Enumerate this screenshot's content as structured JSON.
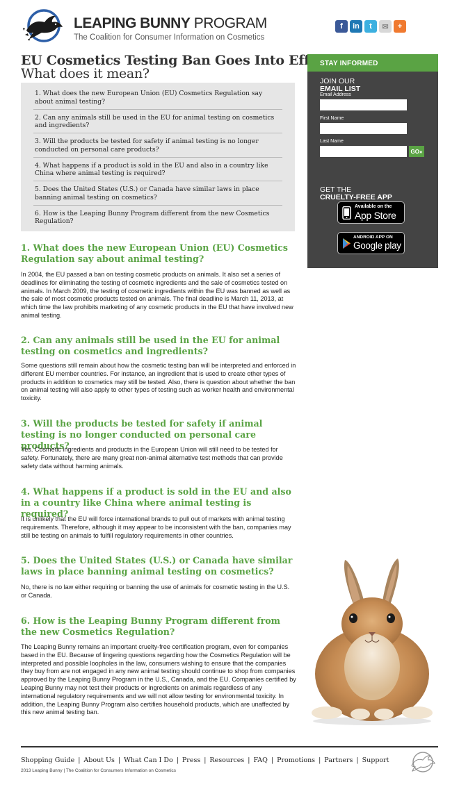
{
  "header": {
    "brand_bold": "LEAPING BUNNY",
    "brand_light": " PROGRAM",
    "tagline": "The Coalition for Consumer Information on Cosmetics",
    "social": [
      {
        "name": "facebook-icon",
        "glyph": "f",
        "color": "#3b5998"
      },
      {
        "name": "linkedin-icon",
        "glyph": "in",
        "color": "#1e78b4"
      },
      {
        "name": "twitter-icon",
        "glyph": "t",
        "color": "#3cb0e0"
      },
      {
        "name": "email-icon",
        "glyph": "✉",
        "color": "#d8d8d8"
      },
      {
        "name": "plus-icon",
        "glyph": "+",
        "color": "#f07a30"
      }
    ]
  },
  "page": {
    "title": "EU Cosmetics Testing Ban Goes Into Effect",
    "subtitle": "What does it mean?"
  },
  "faq": [
    "1. What does the new European Union (EU) Cosmetics Regulation say about animal testing?",
    "2. Can any animals still be used in the EU for animal testing on cosmetics and ingredients?",
    "3. Will the products be tested for safety if animal testing is no longer conducted on personal care products?",
    "4. What happens if a product is sold in the EU and also in a country like China where animal testing is required?",
    "5. Does the United States (U.S.) or Canada have similar laws in place banning animal testing on cosmetics?",
    "6. How is the Leaping Bunny Program different from the new Cosmetics Regulation?"
  ],
  "sections": [
    {
      "heading": "1. What does the new European Union (EU) Cosmetics Regulation say about animal testing?",
      "body": "In 2004, the EU passed a ban on testing cosmetic products on animals.  It also set a series of deadlines for eliminating the testing of cosmetic ingredients and the sale of cosmetics tested on animals.  In March 2009, the testing of cosmetic ingredients within the EU was banned as well as the sale of most cosmetic products tested on animals.  The final deadline is March 11, 2013, at which time the law prohibits marketing of any cosmetic products in the EU that have involved new animal testing."
    },
    {
      "heading": "2. Can any animals still be used in the EU for animal testing on cosmetics and ingredients?",
      "body": "Some questions still remain about how the cosmetic testing ban will be interpreted and enforced in different EU member countries.  For instance, an ingredient that is used to create other types of products in addition to cosmetics may still be tested.  Also, there is question about whether the ban on animal testing will also apply to other types of testing such as worker health and environmental toxicity."
    },
    {
      "heading": "3. Will the products be tested for safety if animal testing is no longer conducted on personal care products?",
      "body": "Yes.  Cosmetic ingredients and products in the European Union will still need to be tested for safety.  Fortunately, there are many great non-animal alternative test methods that can provide safety data without harming animals."
    },
    {
      "heading": "4. What happens if a product is sold in the EU and also in a country like China where animal testing is required?",
      "body": "It is unlikely that the EU will force international brands to pull out of markets with animal testing requirements.  Therefore, although it may appear to be inconsistent with the ban, companies may still be testing on animals to fulfill regulatory requirements in other countries."
    },
    {
      "heading": "5. Does the United States (U.S.) or Canada have similar laws in place banning animal testing on cosmetics?",
      "body": "No, there is no law either requiring or banning the use of animals for cosmetic testing in the U.S. or Canada."
    },
    {
      "heading": "6. How is the Leaping Bunny Program different from the new Cosmetics Regulation?",
      "body": "The Leaping Bunny remains an important cruelty-free certification program, even for companies based in the EU.  Because of lingering questions regarding how the Cosmetics Regulation will be interpreted and possible loopholes in the law, consumers wishing to ensure that the companies they buy from are not engaged in any new animal testing should continue to shop from companies approved by the Leaping Bunny Program in the U.S., Canada, and the EU.  Companies certified by Leaping Bunny may not test their products or ingredients on animals regardless of any international regulatory requirements and we will not allow testing for environmental toxicity.  In addition, the Leaping Bunny Program also certifies household products, which are unaffected by this new animal testing ban."
    }
  ],
  "sidebar": {
    "header": "STAY INFORMED",
    "join_line1": "JOIN OUR",
    "join_line2": "EMAIL LIST",
    "email_label": "Email Address",
    "first_name_label": "First Name",
    "last_name_label": "Last Name",
    "go_label": "GO»",
    "app_line1": "GET THE",
    "app_line2": "CRUELTY-FREE APP",
    "appstore_small": "Available on the",
    "appstore_big": "App Store",
    "googleplay_small": "ANDROID APP ON",
    "googleplay_big": "Google play"
  },
  "footer": {
    "nav": [
      "Shopping Guide",
      "About Us",
      "What Can I Do",
      "Press",
      "Resources",
      "FAQ",
      "Promotions",
      "Partners",
      "Support"
    ],
    "copyright": "2013 Leaping Bunny | The Coalition for Consumers Information on Cosmetics"
  }
}
